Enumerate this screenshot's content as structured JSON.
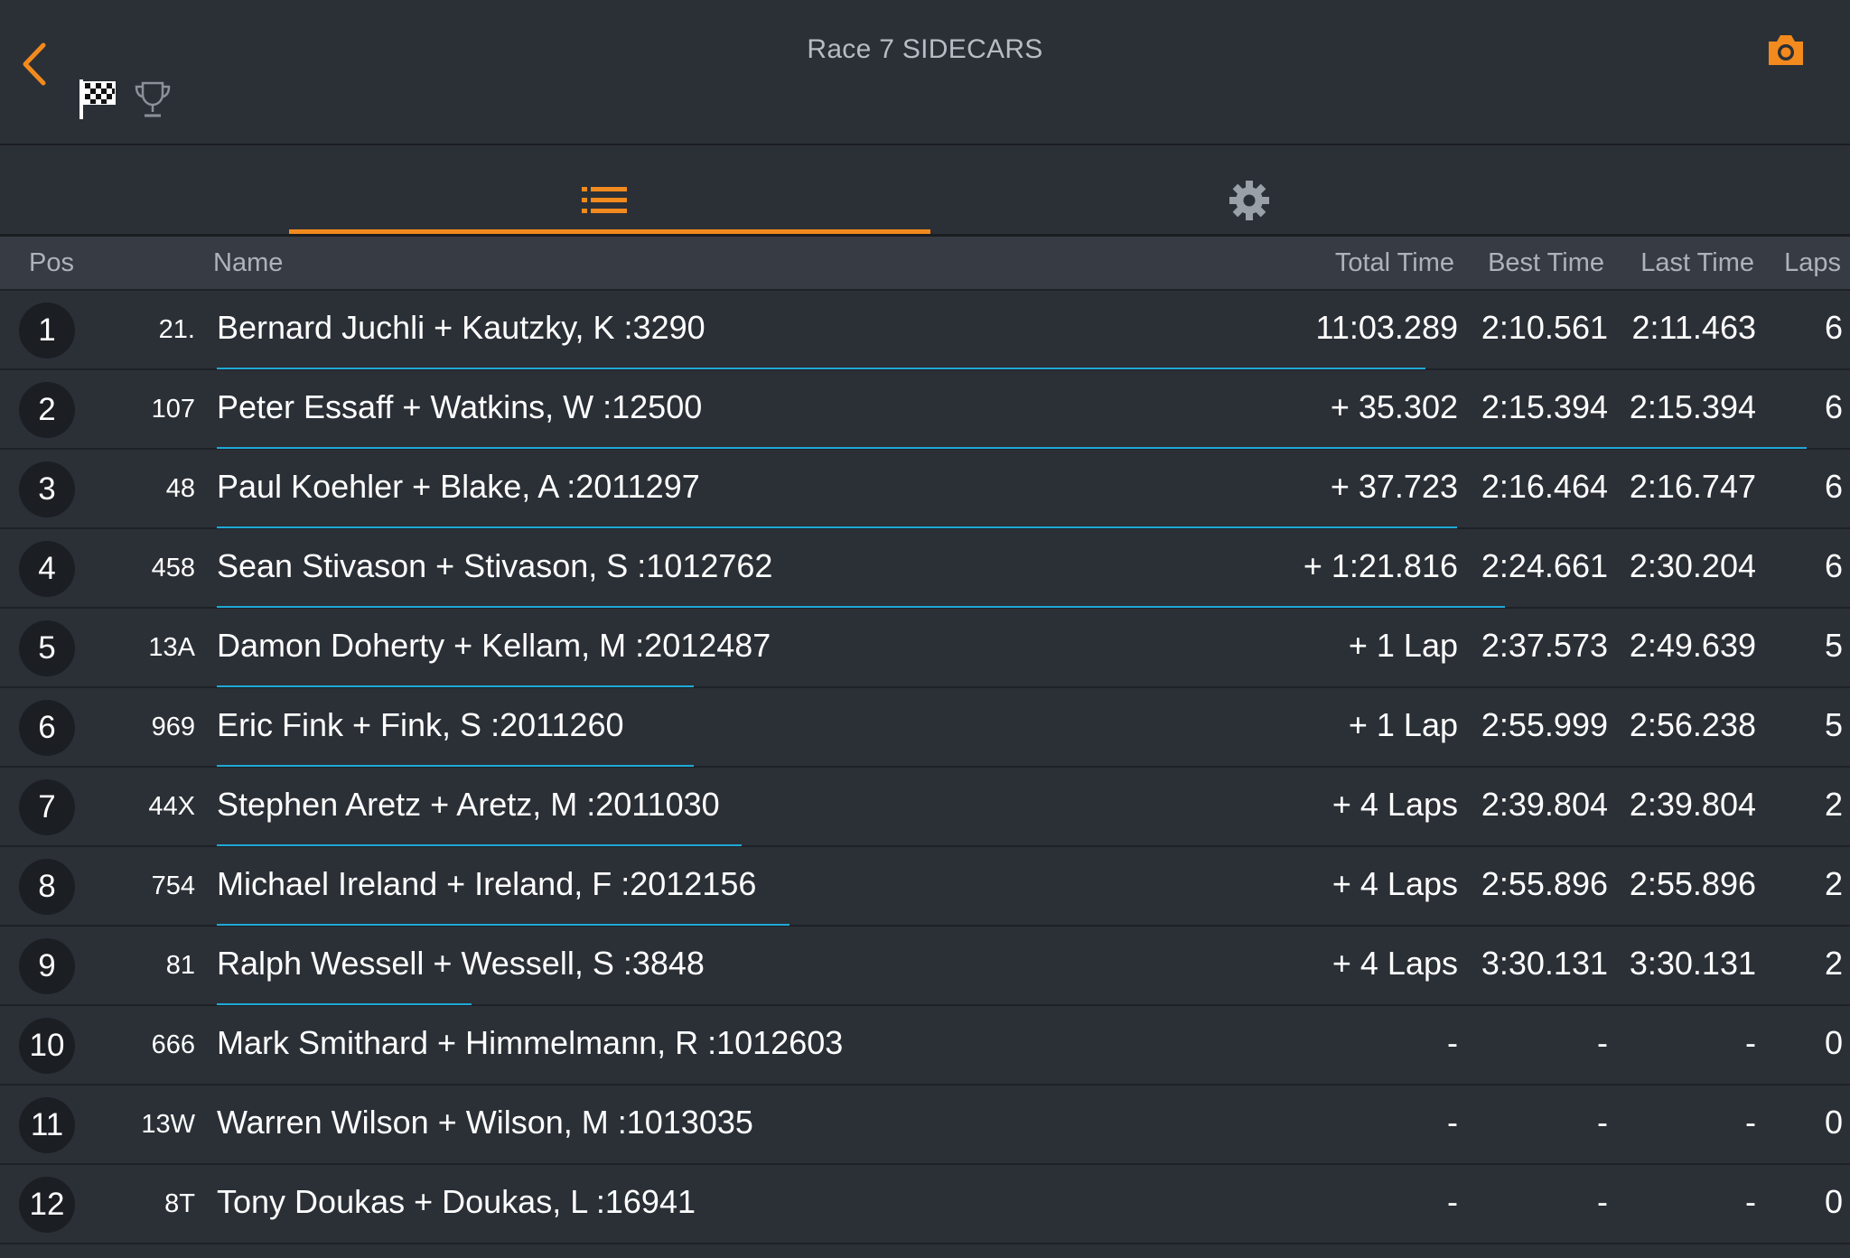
{
  "header": {
    "title": "Race 7 SIDECARS"
  },
  "colors": {
    "accent": "#f28a1e",
    "progress": "#1fa9d6",
    "background": "#2b3037",
    "header_row": "#363b44"
  },
  "icons": {
    "back": "chevron-left-icon",
    "flag": "checkered-flag-icon",
    "trophy": "trophy-icon",
    "camera": "camera-icon",
    "list": "list-icon",
    "settings": "gear-icon"
  },
  "columns": {
    "pos": "Pos",
    "name": "Name",
    "total_time": "Total Time",
    "best_time": "Best Time",
    "last_time": "Last Time",
    "laps": "Laps"
  },
  "rows": [
    {
      "pos": "1",
      "num": "21.",
      "name": "Bernard Juchli + Kautzky, K :3290",
      "total": "11:03.289",
      "best": "2:10.561",
      "last": "2:11.463",
      "laps": "6",
      "progress": 0.76
    },
    {
      "pos": "2",
      "num": "107",
      "name": "Peter Essaff + Watkins, W :12500",
      "total": "+ 35.302",
      "best": "2:15.394",
      "last": "2:15.394",
      "laps": "6",
      "progress": 1.0
    },
    {
      "pos": "3",
      "num": "48",
      "name": "Paul Koehler + Blake, A :2011297",
      "total": "+ 37.723",
      "best": "2:16.464",
      "last": "2:16.747",
      "laps": "6",
      "progress": 0.78
    },
    {
      "pos": "4",
      "num": "458",
      "name": "Sean Stivason + Stivason, S :1012762",
      "total": "+ 1:21.816",
      "best": "2:24.661",
      "last": "2:30.204",
      "laps": "6",
      "progress": 0.81
    },
    {
      "pos": "5",
      "num": "13A",
      "name": "Damon Doherty + Kellam, M :2012487",
      "total": "+ 1 Lap",
      "best": "2:37.573",
      "last": "2:49.639",
      "laps": "5",
      "progress": 0.3
    },
    {
      "pos": "6",
      "num": "969",
      "name": "Eric Fink + Fink, S :2011260",
      "total": "+ 1 Lap",
      "best": "2:55.999",
      "last": "2:56.238",
      "laps": "5",
      "progress": 0.3
    },
    {
      "pos": "7",
      "num": "44X",
      "name": "Stephen Aretz + Aretz, M :2011030",
      "total": "+ 4 Laps",
      "best": "2:39.804",
      "last": "2:39.804",
      "laps": "2",
      "progress": 0.33
    },
    {
      "pos": "8",
      "num": "754",
      "name": "Michael Ireland + Ireland, F :2012156",
      "total": "+ 4 Laps",
      "best": "2:55.896",
      "last": "2:55.896",
      "laps": "2",
      "progress": 0.36
    },
    {
      "pos": "9",
      "num": "81",
      "name": "Ralph Wessell + Wessell, S :3848",
      "total": "+ 4 Laps",
      "best": "3:30.131",
      "last": "3:30.131",
      "laps": "2",
      "progress": 0.16
    },
    {
      "pos": "10",
      "num": "666",
      "name": "Mark Smithard + Himmelmann, R :1012603",
      "total": "-",
      "best": "-",
      "last": "-",
      "laps": "0",
      "progress": 0
    },
    {
      "pos": "11",
      "num": "13W",
      "name": "Warren Wilson + Wilson, M :1013035",
      "total": "-",
      "best": "-",
      "last": "-",
      "laps": "0",
      "progress": 0
    },
    {
      "pos": "12",
      "num": "8T",
      "name": "Tony Doukas + Doukas, L :16941",
      "total": "-",
      "best": "-",
      "last": "-",
      "laps": "0",
      "progress": 0
    }
  ]
}
